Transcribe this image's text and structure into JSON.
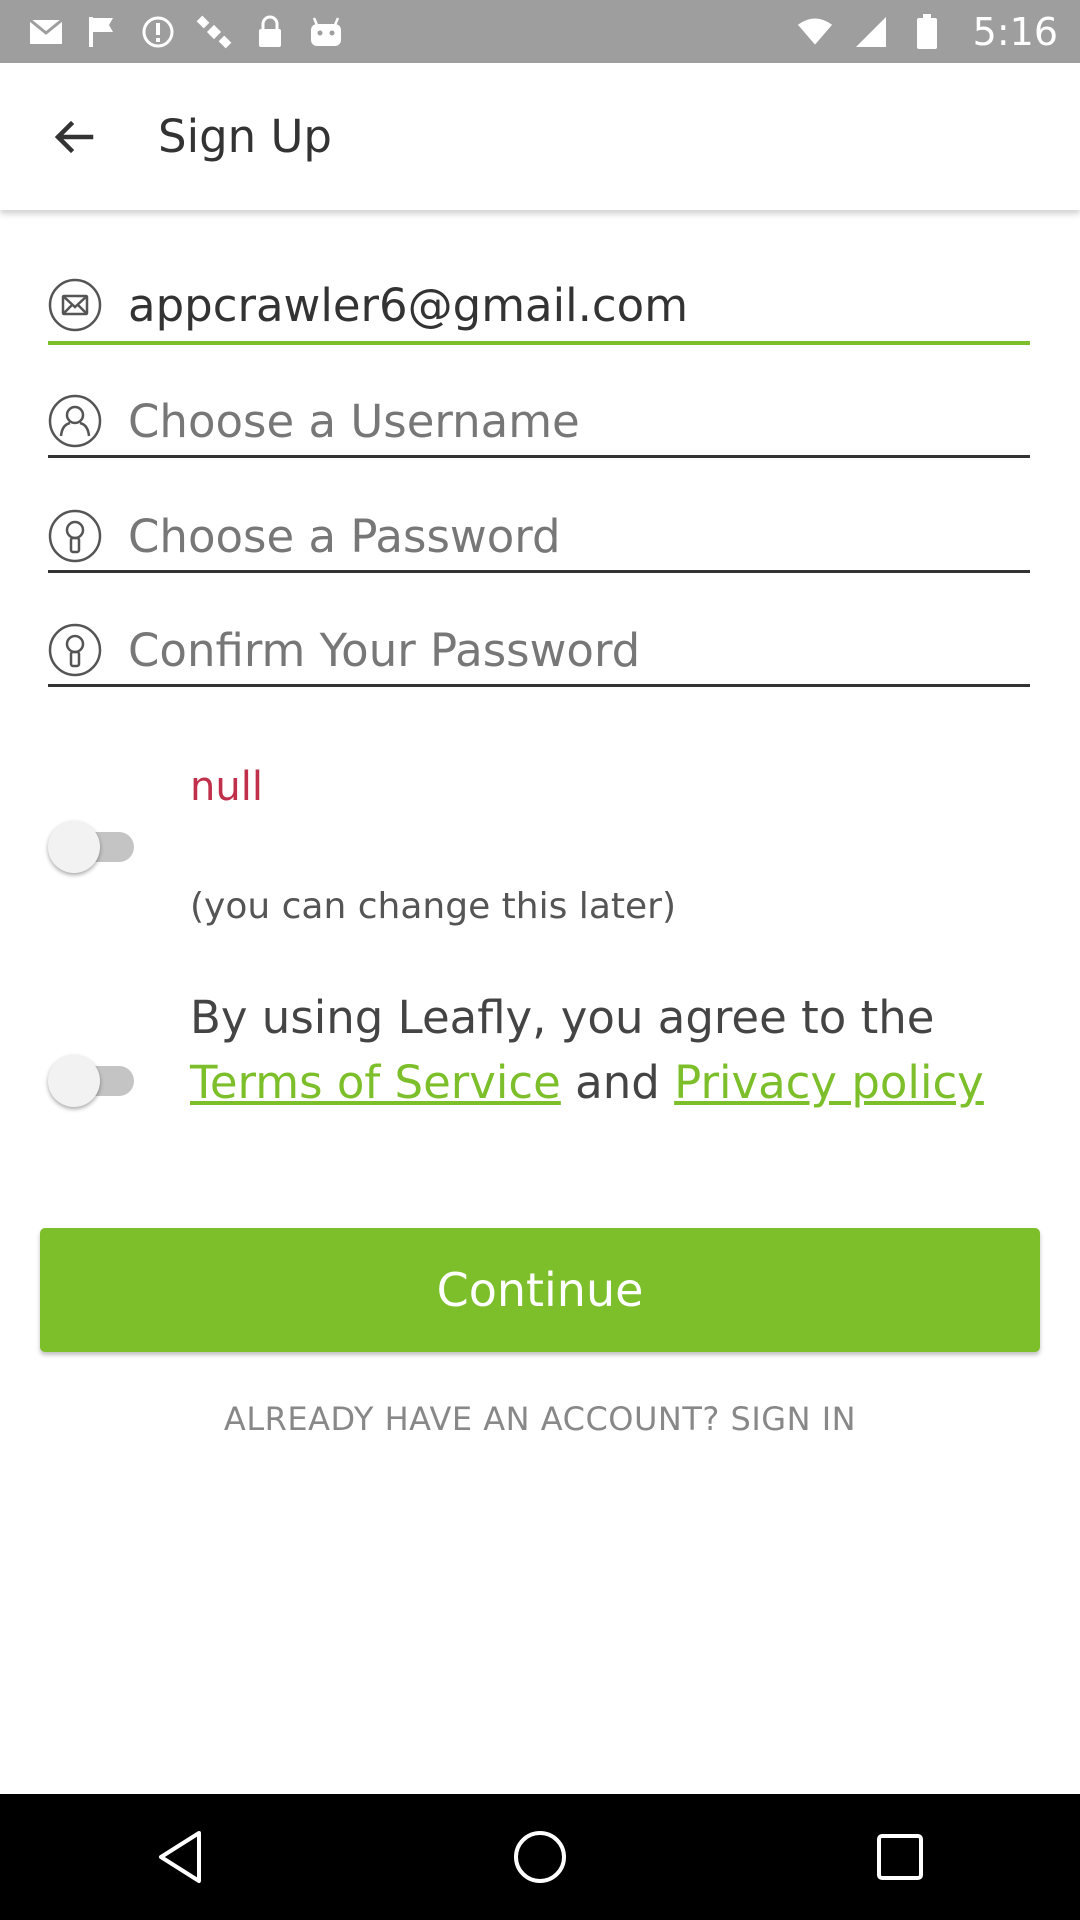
{
  "status_bar": {
    "time": "5:16",
    "icons": [
      "mail-icon",
      "flag-icon",
      "alert-icon",
      "satellite-icon",
      "lock-icon",
      "android-icon",
      "wifi-icon",
      "signal-icon",
      "battery-icon"
    ]
  },
  "app_bar": {
    "title": "Sign Up",
    "back_icon": "arrow-back-icon"
  },
  "form": {
    "email": {
      "value": "appcrawler6@gmail.com",
      "icon": "mail-icon"
    },
    "username": {
      "placeholder": "Choose a Username",
      "icon": "user-icon"
    },
    "password": {
      "placeholder": "Choose a Password",
      "icon": "lock-icon"
    },
    "confirm_password": {
      "placeholder": "Confirm Your Password",
      "icon": "lock-icon"
    }
  },
  "toggle_one": {
    "label": "null",
    "hint": "(you can change this later)",
    "on": false
  },
  "terms": {
    "text_prefix": "By using Leafly, you agree to the",
    "tos_link": "Terms of Service",
    "joiner": "and",
    "privacy_link": "Privacy policy",
    "on": false
  },
  "actions": {
    "continue_label": "Continue",
    "signin_label": "ALREADY HAVE AN ACCOUNT? SIGN IN"
  },
  "colors": {
    "accent": "#7cbf2a",
    "error": "#c0304a",
    "status_bar": "#9e9e9e"
  },
  "nav_bar": {
    "buttons": [
      "back-triangle-icon",
      "home-circle-icon",
      "recents-square-icon"
    ]
  }
}
